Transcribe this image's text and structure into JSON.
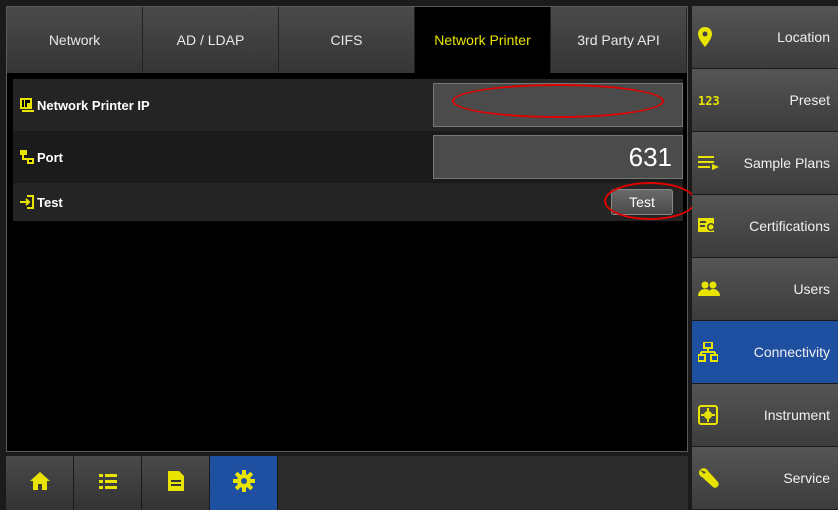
{
  "tabs": [
    {
      "label": "Network",
      "active": false
    },
    {
      "label": "AD / LDAP",
      "active": false
    },
    {
      "label": "CIFS",
      "active": false
    },
    {
      "label": "Network Printer",
      "active": true
    },
    {
      "label": "3rd Party API",
      "active": false
    }
  ],
  "rows": {
    "printer_ip": {
      "label": "Network Printer IP",
      "value": "",
      "icon": "printer-ip-icon"
    },
    "port": {
      "label": "Port",
      "value": "631",
      "icon": "network-port-icon"
    },
    "test": {
      "label": "Test",
      "button_label": "Test",
      "icon": "enter-arrow-icon"
    }
  },
  "bottom_bar": {
    "buttons": [
      "home-icon",
      "list-icon",
      "document-icon",
      "gear-icon"
    ],
    "active": "gear-icon"
  },
  "sidebar": {
    "items": [
      {
        "label": "Location",
        "icon": "location-pin-icon",
        "active": false
      },
      {
        "label": "Preset",
        "icon": "123-icon",
        "active": false
      },
      {
        "label": "Sample Plans",
        "icon": "list-arrow-icon",
        "active": false
      },
      {
        "label": "Certifications",
        "icon": "certificate-icon",
        "active": false
      },
      {
        "label": "Users",
        "icon": "users-icon",
        "active": false
      },
      {
        "label": "Connectivity",
        "icon": "network-icon",
        "active": true
      },
      {
        "label": "Instrument",
        "icon": "instrument-icon",
        "active": false
      },
      {
        "label": "Service",
        "icon": "wrench-icon",
        "active": false
      }
    ]
  },
  "colors": {
    "accent_yellow": "#e8e400",
    "active_blue": "#1f4fa0",
    "annotation_red": "#e00000"
  }
}
